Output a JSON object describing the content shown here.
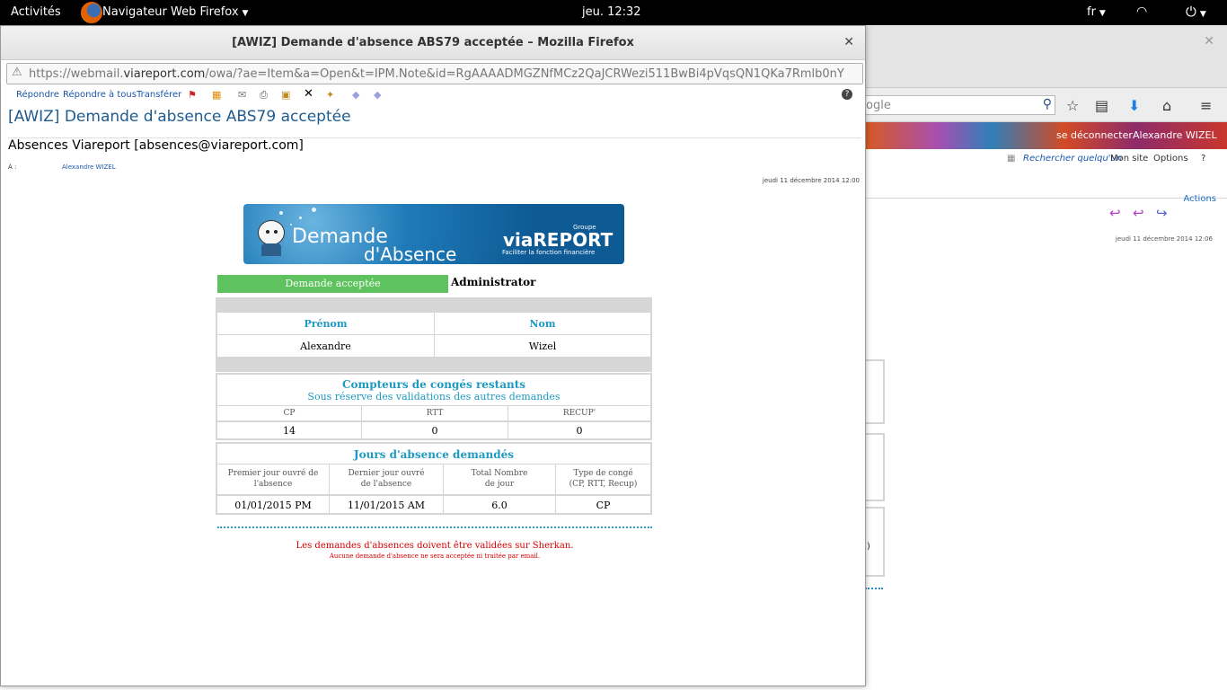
{
  "topbar": {
    "activities": "Activités",
    "app_menu": "Navigateur Web Firefox",
    "clock": "jeu. 12:32",
    "lang": "fr"
  },
  "background_browser": {
    "search_placeholder": "ogle",
    "logout": "se déconnecter",
    "user": "Alexandre WIZEL",
    "find_someone": "Rechercher quelqu'un",
    "my_site": "Mon site",
    "options": "Options",
    "actions": "Actions",
    "date": "jeudi 11 décembre 2014 12:06",
    "paren": ")"
  },
  "window": {
    "title": "[AWIZ] Demande d'absence ABS79 acceptée – Mozilla Firefox",
    "url_prefix": "https://webmail.",
    "url_domain": "viareport.com",
    "url_suffix": "/owa/?ae=Item&a=Open&t=IPM.Note&id=RgAAAADMGZNfMCz2QaJCRWezi511BwBi4pVqsQN1QKa7Rmlb0nY"
  },
  "toolbar": {
    "reply": "Répondre",
    "reply_all": "Répondre à tous",
    "forward": "Transférer"
  },
  "mail": {
    "subject": "[AWIZ] Demande d'absence ABS79 acceptée",
    "sender": "Absences Viareport [absences@viareport.com]",
    "to_label": "À :",
    "to_value": "Alexandre WIZEL",
    "date": "jeudi 11 décembre 2014 12:00"
  },
  "banner": {
    "line1": "Demande",
    "line2": "d'Absence",
    "logo": "viaREPORT",
    "groupe": "Groupe",
    "tagline": "Faciliter la fonction financière"
  },
  "status": {
    "label": "Demande acceptée",
    "by": "Administrator"
  },
  "person": {
    "headers": [
      "Prénom",
      "Nom"
    ],
    "values": [
      "Alexandre",
      "Wizel"
    ]
  },
  "counters": {
    "title": "Compteurs de congés restants",
    "subtitle": "Sous réserve des validations des autres demandes",
    "headers": [
      "CP",
      "RTT",
      "RECUP'"
    ],
    "values": [
      "14",
      "0",
      "0"
    ]
  },
  "days": {
    "title": "Jours d'absence demandés",
    "headers": [
      {
        "l1": "Premier jour ouvré de",
        "l2": "l'absence"
      },
      {
        "l1": "Dernier jour ouvré",
        "l2": "de l'absence"
      },
      {
        "l1": "Total Nombre",
        "l2": "de jour"
      },
      {
        "l1": "Type de congé",
        "l2": "(CP, RTT, Recup)"
      }
    ],
    "values": [
      "01/01/2015 PM",
      "11/01/2015 AM",
      "6.0",
      "CP"
    ]
  },
  "notice": {
    "line1": "Les demandes d'absences doivent être validées sur Sherkan.",
    "line2": "Aucune demande d'absence ne sera acceptée ni traitée par email."
  },
  "colors": {
    "accent_teal": "#1d9ac0",
    "status_green": "#5ec35e",
    "notice_red": "#d40000",
    "link_blue": "#1a56a8"
  }
}
